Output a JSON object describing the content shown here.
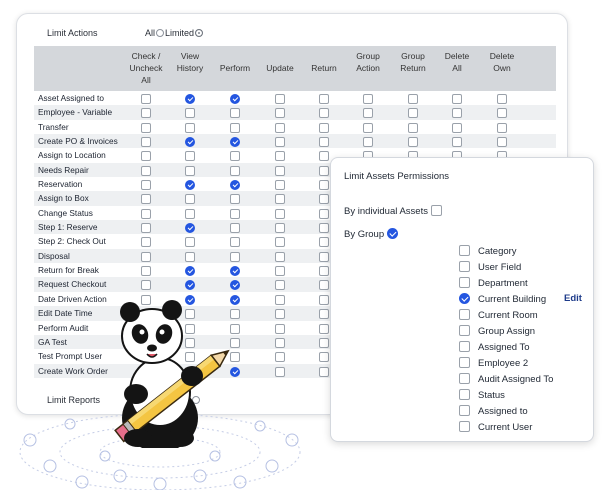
{
  "limit_actions": {
    "label": "Limit Actions",
    "all": "All",
    "limited": "Limited"
  },
  "limit_reports": {
    "label": "Limit Reports",
    "limited_suffix": "ited"
  },
  "columns": [
    {
      "l1": "Check /",
      "l2": "Uncheck",
      "l3": "All"
    },
    {
      "l1": "View",
      "l2": "History",
      "l3": ""
    },
    {
      "l1": "",
      "l2": "Perform",
      "l3": ""
    },
    {
      "l1": "",
      "l2": "Update",
      "l3": ""
    },
    {
      "l1": "",
      "l2": "Return",
      "l3": ""
    },
    {
      "l1": "Group",
      "l2": "Action",
      "l3": ""
    },
    {
      "l1": "Group",
      "l2": "Return",
      "l3": ""
    },
    {
      "l1": "Delete",
      "l2": "All",
      "l3": ""
    },
    {
      "l1": "Delete",
      "l2": "Own",
      "l3": ""
    }
  ],
  "rows": [
    {
      "label": "Asset Assigned to",
      "checked": [
        false,
        true,
        true,
        false,
        false,
        false,
        false,
        false,
        false
      ]
    },
    {
      "label": "Employee - Variable",
      "checked": [
        false,
        false,
        false,
        false,
        false,
        false,
        false,
        false,
        false
      ]
    },
    {
      "label": "Transfer",
      "checked": [
        false,
        false,
        false,
        false,
        false,
        false,
        false,
        false,
        false
      ]
    },
    {
      "label": "Create PO & Invoices",
      "checked": [
        false,
        true,
        true,
        false,
        false,
        false,
        false,
        false,
        false
      ]
    },
    {
      "label": "Assign to Location",
      "checked": [
        false,
        false,
        false,
        false,
        false,
        false,
        false,
        false,
        false
      ]
    },
    {
      "label": "Needs Repair",
      "checked": [
        false,
        false,
        false,
        false,
        false,
        false,
        false,
        false,
        false
      ]
    },
    {
      "label": "Reservation",
      "checked": [
        false,
        true,
        true,
        false,
        false,
        false,
        false,
        false,
        false
      ]
    },
    {
      "label": "Assign to Box",
      "checked": [
        false,
        false,
        false,
        false,
        false,
        false,
        false,
        false,
        false
      ]
    },
    {
      "label": "Change Status",
      "checked": [
        false,
        false,
        false,
        false,
        false,
        false,
        false,
        false,
        false
      ]
    },
    {
      "label": "Step 1: Reserve",
      "checked": [
        false,
        true,
        false,
        false,
        false,
        false,
        false,
        false,
        false
      ]
    },
    {
      "label": "Step 2: Check Out",
      "checked": [
        false,
        false,
        false,
        false,
        false,
        false,
        false,
        false,
        false
      ]
    },
    {
      "label": "Disposal",
      "checked": [
        false,
        false,
        false,
        false,
        false,
        false,
        false,
        false,
        false
      ]
    },
    {
      "label": "Return for Break",
      "checked": [
        false,
        true,
        true,
        false,
        false,
        false,
        false,
        false,
        false
      ]
    },
    {
      "label": "Request Checkout",
      "checked": [
        false,
        true,
        true,
        false,
        false,
        false,
        false,
        false,
        false
      ]
    },
    {
      "label": "Date Driven Action",
      "checked": [
        false,
        true,
        true,
        false,
        false,
        false,
        false,
        false,
        false
      ]
    },
    {
      "label": "Edit Date Time",
      "checked": [
        false,
        false,
        false,
        false,
        false,
        false,
        false,
        false,
        false
      ]
    },
    {
      "label": "Perform Audit",
      "checked": [
        false,
        false,
        false,
        false,
        false,
        false,
        false,
        false,
        false
      ]
    },
    {
      "label": "GA Test",
      "checked": [
        false,
        false,
        false,
        false,
        false,
        false,
        false,
        false,
        false
      ]
    },
    {
      "label": "Test Prompt User",
      "checked": [
        false,
        false,
        false,
        false,
        false,
        false,
        false,
        false,
        false
      ]
    },
    {
      "label": "Create Work Order",
      "checked": [
        false,
        true,
        true,
        false,
        false,
        false,
        false,
        false,
        false
      ]
    }
  ],
  "popup": {
    "title": "Limit Assets Permissions",
    "by_individual": "By individual Assets",
    "by_group": "By Group",
    "edit_label": "Edit",
    "items": [
      {
        "label": "Category",
        "checked": false
      },
      {
        "label": "User Field",
        "checked": false
      },
      {
        "label": "Department",
        "checked": false
      },
      {
        "label": "Current Building",
        "checked": true
      },
      {
        "label": "Current Room",
        "checked": false
      },
      {
        "label": "Group Assign",
        "checked": false
      },
      {
        "label": "Assigned To",
        "checked": false
      },
      {
        "label": "Employee 2",
        "checked": false
      },
      {
        "label": "Audit Assigned To",
        "checked": false
      },
      {
        "label": "Status",
        "checked": false
      },
      {
        "label": "Assigned to",
        "checked": false
      },
      {
        "label": "Current User",
        "checked": false
      }
    ]
  },
  "colors": {
    "accent": "#2456e0",
    "header_bg": "#d4d7db",
    "alt_row": "#eef0f2",
    "link": "#1e3b8a"
  }
}
